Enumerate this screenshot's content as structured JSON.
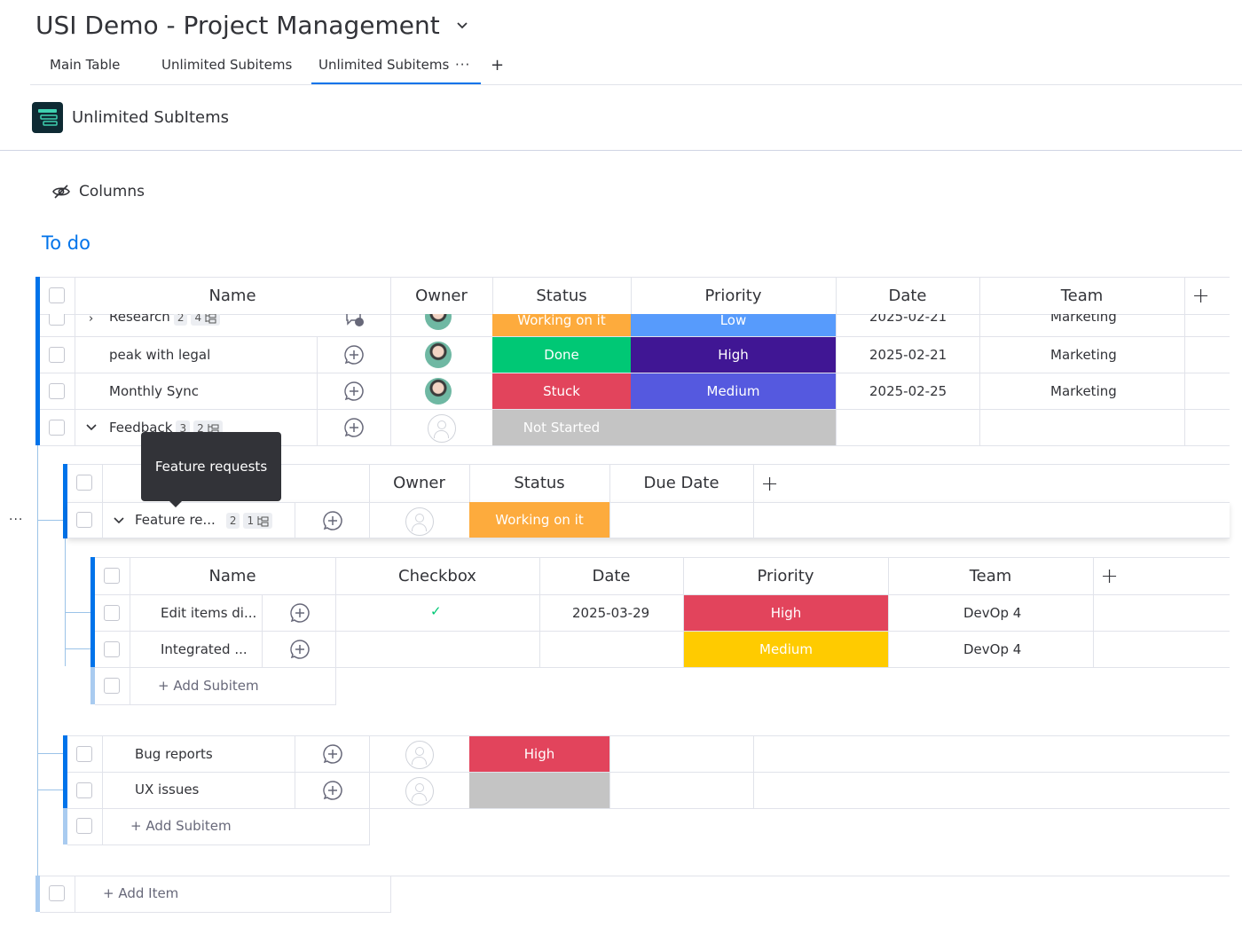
{
  "board": {
    "title": "USI Demo - Project Management"
  },
  "tabs": [
    {
      "label": "Main Table"
    },
    {
      "label": "Unlimited Subitems"
    },
    {
      "label": "Unlimited Subitems"
    }
  ],
  "app": {
    "name": "Unlimited SubItems"
  },
  "toolbar": {
    "columns_label": "Columns"
  },
  "group": {
    "title": "To do",
    "color": "#0073ea"
  },
  "main_table": {
    "headers": [
      "Name",
      "Owner",
      "Status",
      "Priority",
      "Date",
      "Team"
    ],
    "rows": [
      {
        "name": "Research",
        "sub_count": "2",
        "subitems_count": "4",
        "status": "Working on it",
        "status_color": "#fdab3d",
        "priority": "Low",
        "priority_color": "#579bfc",
        "date": "2025-02-21",
        "team": "Marketing",
        "updates": "1"
      },
      {
        "name": "peak with legal",
        "status": "Done",
        "status_color": "#00c875",
        "priority": "High",
        "priority_color": "#401694",
        "date": "2025-02-21",
        "team": "Marketing"
      },
      {
        "name": "Monthly Sync",
        "status": "Stuck",
        "status_color": "#e2445c",
        "priority": "Medium",
        "priority_color": "#5559df",
        "date": "2025-02-25",
        "team": "Marketing"
      },
      {
        "name": "Feedback",
        "sub_count": "3",
        "subitems_count": "2",
        "status": "Not Started",
        "status_color": "#c4c4c4",
        "priority": "",
        "priority_color": "#c4c4c4",
        "date": "",
        "team": ""
      }
    ],
    "add_item": "+ Add Item"
  },
  "tooltip": {
    "text": "Feature requests"
  },
  "sub_table": {
    "headers": [
      "Owner",
      "Status",
      "Due Date"
    ],
    "rows": [
      {
        "name": "Feature re...",
        "sub_count": "2",
        "subitems_count": "1",
        "status": "Working on it",
        "status_color": "#fdab3d"
      },
      {
        "name": "Bug reports",
        "status": "High",
        "status_color": "#e2445c"
      },
      {
        "name": "UX issues",
        "status": "",
        "status_color": "#c4c4c4"
      }
    ],
    "add_subitem": "+ Add Subitem"
  },
  "subsub_table": {
    "headers": [
      "Name",
      "Checkbox",
      "Date",
      "Priority",
      "Team"
    ],
    "rows": [
      {
        "name": "Edit items di...",
        "checked": "✓",
        "date": "2025-03-29",
        "priority": "High",
        "priority_color": "#e2445c",
        "team": "DevOp 4"
      },
      {
        "name": "Integrated ...",
        "checked": "",
        "date": "",
        "priority": "Medium",
        "priority_color": "#ffcb00",
        "team": "DevOp 4"
      }
    ],
    "add_subitem": "+ Add Subitem"
  }
}
